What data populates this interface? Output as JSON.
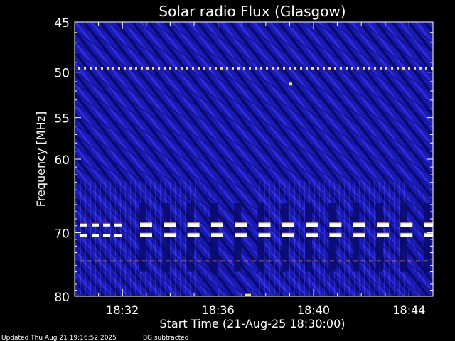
{
  "chart_data": {
    "type": "heatmap",
    "title": "Solar radio Flux (Glasgow)",
    "xlabel": "Start Time (21-Aug-25 18:30:00)",
    "ylabel": "Frequency [MHz]",
    "x_range": [
      "18:30:00",
      "18:45:00"
    ],
    "y_scale": "log",
    "y_range_mhz": [
      45,
      80
    ],
    "x_ticks": [
      "18:32",
      "18:36",
      "18:40",
      "18:44"
    ],
    "y_ticks": [
      45,
      50,
      55,
      60,
      70,
      80
    ],
    "interference_lines_mhz": [
      49.6,
      68.9,
      70.4,
      74.3
    ],
    "colors": {
      "background": "#000000",
      "spectrogram_base": "#1a1ab4",
      "spectrogram_dark": "#0a0a6e",
      "spectrogram_light": "#3c3cff",
      "burst_white": "#ffffff",
      "burst_yellow": "#ffe066",
      "burst_red": "#ff3030",
      "axes": "#ffffff"
    }
  },
  "footer": {
    "updated": "Updated Thu Aug 21 19:16:52 2025",
    "mode": "BG subtracted"
  }
}
